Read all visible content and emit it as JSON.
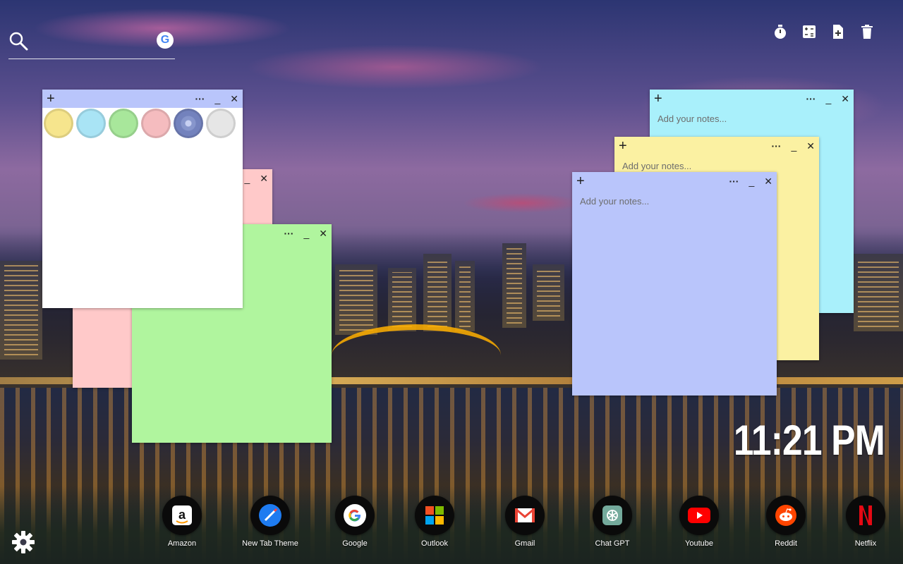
{
  "search": {
    "placeholder": "",
    "engine_icon": "google-icon",
    "engine_letter": "G"
  },
  "toolbar": {
    "icons": [
      "timer-icon",
      "calculator-icon",
      "add-note-icon",
      "trash-icon"
    ]
  },
  "palette_note": {
    "plus": "+",
    "dots": "···",
    "min": "_",
    "close": "✕",
    "colors": [
      "#f6e58d",
      "#a9e4f5",
      "#a8e79b",
      "#f5bcbf",
      "#7f8fc4",
      "#e6e6e6"
    ]
  },
  "notes": [
    {
      "color": "#ffc9c9",
      "placeholder": ""
    },
    {
      "color": "#b0f59e",
      "placeholder": ""
    },
    {
      "color": "#a9f0fb",
      "placeholder": "Add your notes..."
    },
    {
      "color": "#fbf1a2",
      "placeholder": "Add your notes..."
    },
    {
      "color": "#b9c5fb",
      "placeholder": "Add your notes..."
    }
  ],
  "note_buttons": {
    "plus": "+",
    "dots": "···",
    "min": "_",
    "close": "✕"
  },
  "clock": {
    "time": "11:21 PM"
  },
  "dock": [
    {
      "label": "Amazon",
      "icon": "amazon-icon"
    },
    {
      "label": "New Tab Theme",
      "icon": "new-tab-theme-icon"
    },
    {
      "label": "Google",
      "icon": "google-icon"
    },
    {
      "label": "Outlook",
      "icon": "outlook-icon"
    },
    {
      "label": "Gmail",
      "icon": "gmail-icon"
    },
    {
      "label": "Chat GPT",
      "icon": "chatgpt-icon"
    },
    {
      "label": "Youtube",
      "icon": "youtube-icon"
    },
    {
      "label": "Reddit",
      "icon": "reddit-icon"
    },
    {
      "label": "Netflix",
      "icon": "netflix-icon"
    }
  ],
  "settings_icon": "gear-icon"
}
